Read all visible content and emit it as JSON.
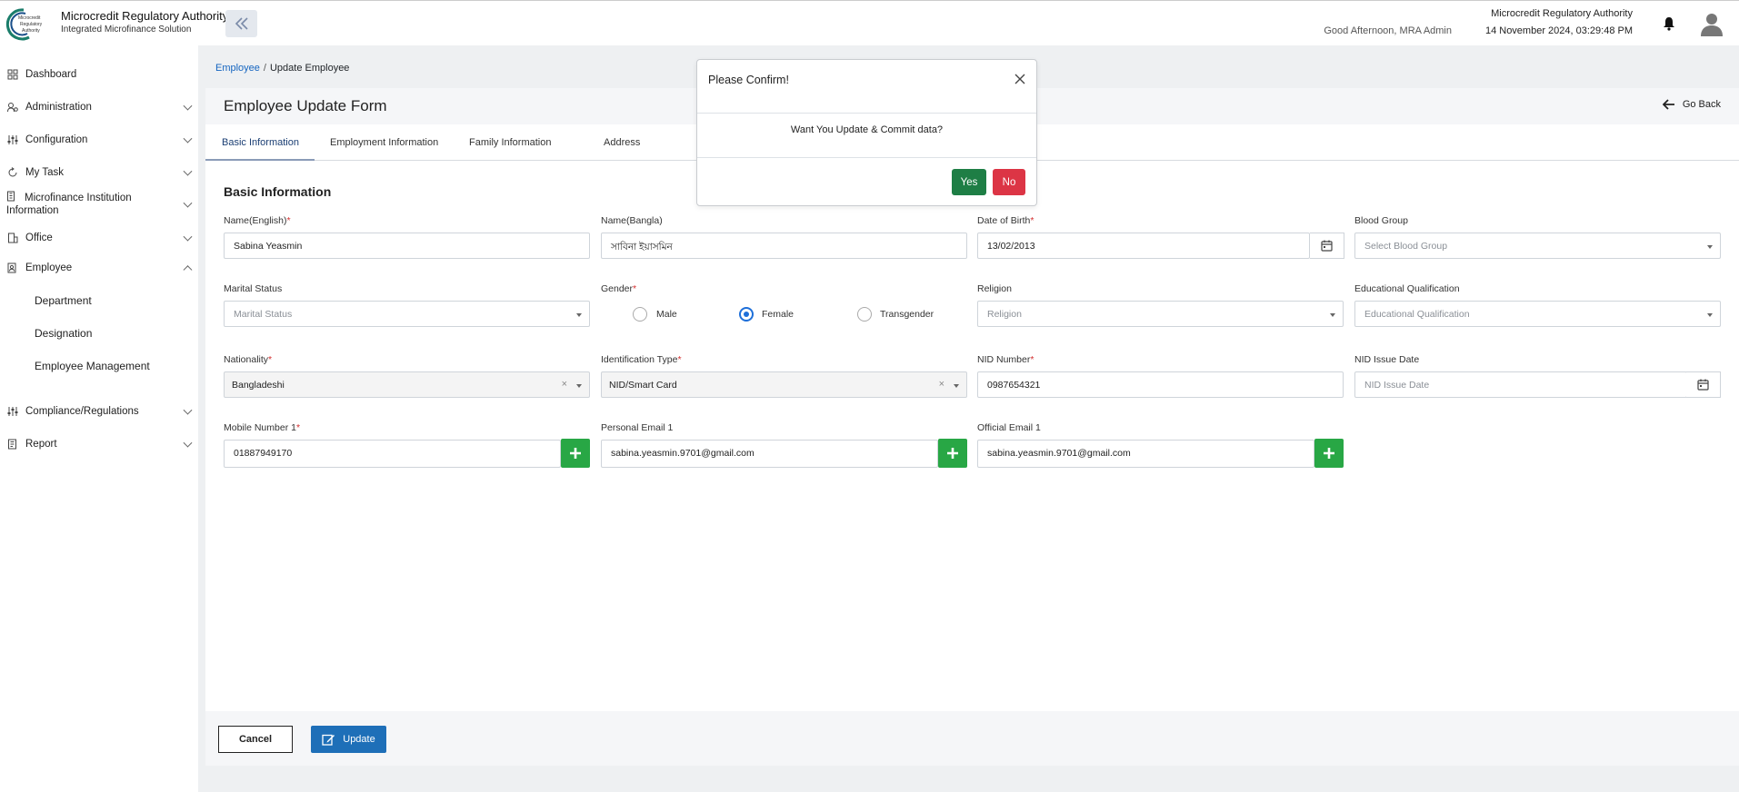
{
  "header": {
    "brand_title": "Microcredit Regulatory Authority",
    "brand_subtitle": "Integrated Microfinance Solution",
    "logo_text": "Microcredit Regulatory Authority",
    "greeting": "Good Afternoon, MRA Admin",
    "org_name": "Microcredit Regulatory Authority",
    "datetime": "14 November 2024, 03:29:48 PM"
  },
  "sidebar": {
    "items": [
      {
        "label": "Dashboard",
        "icon": "grid-icon"
      },
      {
        "label": "Administration",
        "icon": "users-cog-icon"
      },
      {
        "label": "Configuration",
        "icon": "sliders-icon"
      },
      {
        "label": "My Task",
        "icon": "task-cycle-icon"
      },
      {
        "label": "Microfinance Institution",
        "label2": "Information",
        "icon": "building-icon"
      },
      {
        "label": "Office",
        "icon": "office-icon"
      },
      {
        "label": "Employee",
        "icon": "employee-icon"
      },
      {
        "label": "Compliance/Regulations",
        "icon": "sliders-icon"
      },
      {
        "label": "Report",
        "icon": "report-icon"
      }
    ],
    "sub_items": [
      "Department",
      "Designation",
      "Employee Management"
    ]
  },
  "breadcrumb": {
    "parent": "Employee",
    "separator": "/",
    "current": "Update Employee"
  },
  "form": {
    "title": "Employee Update Form",
    "go_back": "Go Back",
    "tabs": [
      "Basic Information",
      "Employment Information",
      "Family Information",
      "Address"
    ],
    "section_title": "Basic Information",
    "fields": {
      "name_en": {
        "label": "Name(English)",
        "value": "Sabina Yeasmin"
      },
      "name_bn": {
        "label": "Name(Bangla)",
        "value": "সাবিনা ইয়াসমিন"
      },
      "dob": {
        "label": "Date of Birth",
        "value": "13/02/2013"
      },
      "blood_group": {
        "label": "Blood Group",
        "placeholder": "Select Blood Group"
      },
      "marital_status": {
        "label": "Marital Status",
        "placeholder": "Marital Status"
      },
      "gender": {
        "label": "Gender",
        "options": [
          "Male",
          "Female",
          "Transgender"
        ],
        "selected": "Female"
      },
      "religion": {
        "label": "Religion",
        "placeholder": "Religion"
      },
      "education": {
        "label": "Educational Qualification",
        "placeholder": "Educational Qualification"
      },
      "nationality": {
        "label": "Nationality",
        "value": "Bangladeshi"
      },
      "id_type": {
        "label": "Identification Type",
        "value": "NID/Smart Card"
      },
      "nid_number": {
        "label": "NID Number",
        "value": "0987654321"
      },
      "nid_issue_date": {
        "label": "NID Issue Date",
        "placeholder": "NID Issue Date"
      },
      "mobile1": {
        "label": "Mobile Number 1",
        "value": "01887949170"
      },
      "personal_email1": {
        "label": "Personal Email 1",
        "value": "sabina.yeasmin.9701@gmail.com"
      },
      "official_email1": {
        "label": "Official Email 1",
        "value": "sabina.yeasmin.9701@gmail.com"
      }
    },
    "required_mark": "*",
    "clear_glyph": "×",
    "cancel_label": "Cancel",
    "update_label": "Update"
  },
  "modal": {
    "title": "Please Confirm!",
    "message": "Want You Update & Commit data?",
    "yes_label": "Yes",
    "no_label": "No"
  },
  "colors": {
    "accent_blue": "#1e6fb8",
    "success": "#28a745",
    "danger": "#dc3545",
    "link": "#1565c0"
  }
}
